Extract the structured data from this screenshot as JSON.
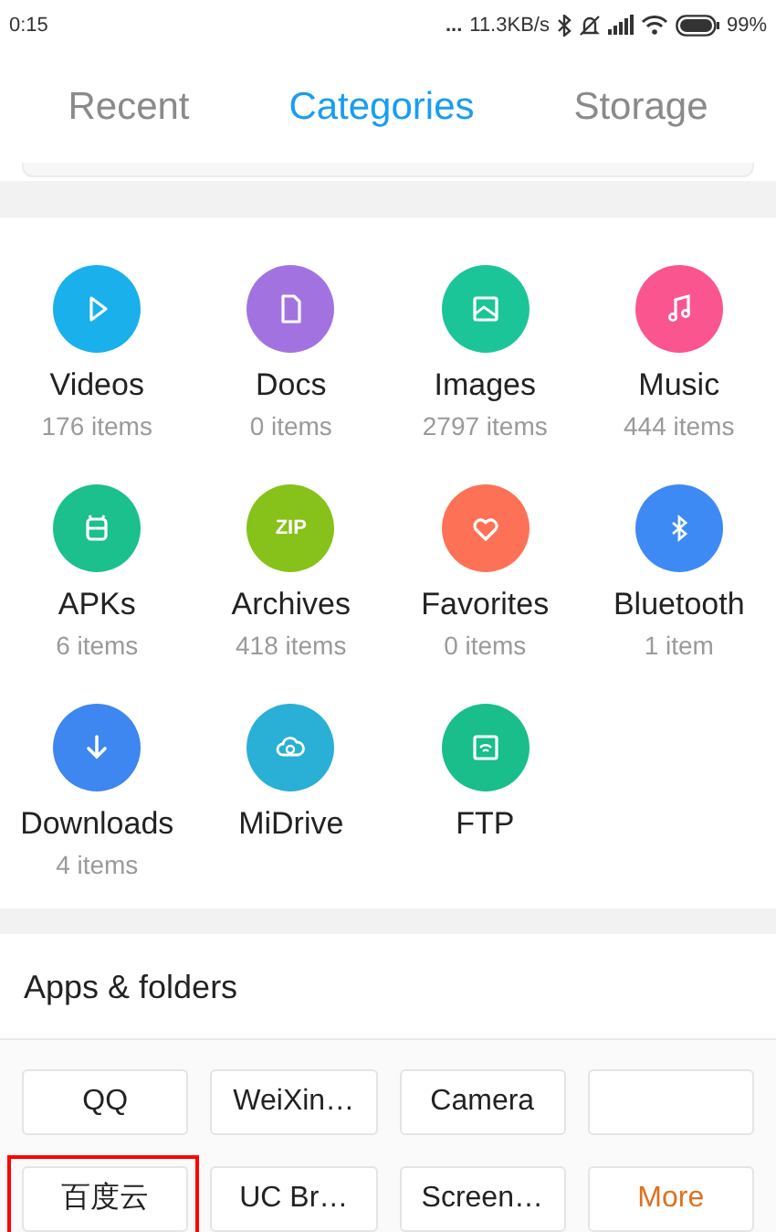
{
  "status_bar": {
    "time": "0:15",
    "dots": "...",
    "speed": "11.3KB/s",
    "battery": "99%"
  },
  "tabs": [
    {
      "label": "Recent",
      "selected": false
    },
    {
      "label": "Categories",
      "selected": true
    },
    {
      "label": "Storage",
      "selected": false
    }
  ],
  "categories": [
    {
      "kind": "video",
      "name": "Videos",
      "count": "176 items",
      "color": "#1ab0ec"
    },
    {
      "kind": "doc",
      "name": "Docs",
      "count": "0 items",
      "color": "#a273e0"
    },
    {
      "kind": "image",
      "name": "Images",
      "count": "2797 items",
      "color": "#1cc597"
    },
    {
      "kind": "music",
      "name": "Music",
      "count": "444 items",
      "color": "#fb5590"
    },
    {
      "kind": "apk",
      "name": "APKs",
      "count": "6 items",
      "color": "#1cc08c"
    },
    {
      "kind": "zip",
      "name": "Archives",
      "count": "418 items",
      "color": "#86c21a",
      "badge": "ZIP"
    },
    {
      "kind": "heart",
      "name": "Favorites",
      "count": "0 items",
      "color": "#fd7257"
    },
    {
      "kind": "bluetooth",
      "name": "Bluetooth",
      "count": "1 item",
      "color": "#3e8af5"
    },
    {
      "kind": "download",
      "name": "Downloads",
      "count": "4 items",
      "color": "#3e86f0"
    },
    {
      "kind": "cloud",
      "name": "MiDrive",
      "color": "#2aafd6"
    },
    {
      "kind": "ftp",
      "name": "FTP",
      "color": "#19be8a"
    }
  ],
  "apps_section": {
    "title": "Apps & folders",
    "chips": [
      {
        "label": "QQ",
        "highlighted": false,
        "kind": "folder"
      },
      {
        "label": "WeiXin…",
        "highlighted": false,
        "kind": "folder"
      },
      {
        "label": "Camera",
        "highlighted": false,
        "kind": "folder"
      },
      {
        "highlighted": false,
        "kind": "folder"
      },
      {
        "label": "百度云",
        "highlighted": true,
        "kind": "folder"
      },
      {
        "label": "UC Br…",
        "highlighted": false,
        "kind": "folder"
      },
      {
        "label": "Screen…",
        "highlighted": false,
        "kind": "folder"
      },
      {
        "label": "More",
        "highlighted": false,
        "kind": "more"
      }
    ]
  }
}
